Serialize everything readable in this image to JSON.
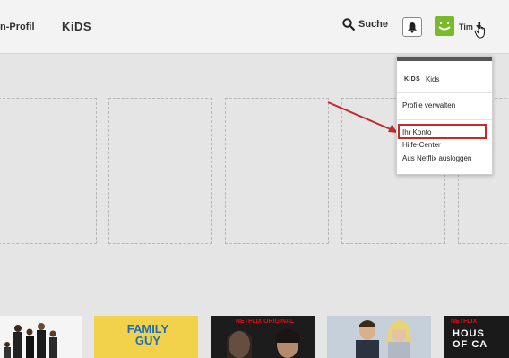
{
  "header": {
    "profile_link": "n-Profil",
    "kids_link": "KiDS",
    "search_label": "Suche",
    "profile_name": "Tim"
  },
  "dropdown": {
    "kids_logo": "KIDS",
    "kids_label": "Kids",
    "items": [
      "Profile verwalten",
      "Ihr Konto",
      "Hilfe-Center",
      "Aus Netflix ausloggen"
    ]
  },
  "rows": {
    "thumbs": [
      {
        "logo": ""
      },
      {
        "logo": "FAMILY GUY"
      },
      {
        "badge": "NETFLIX ORIGINAL"
      },
      {
        "badge": ""
      },
      {
        "badge": "NETFLIX",
        "title": "HOUS OF CA"
      }
    ]
  },
  "colors": {
    "accent_red": "#c52a2a",
    "avatar_green": "#7ab928",
    "netflix_red": "#e50914"
  },
  "icons": [
    "search-icon",
    "bell-icon",
    "smiley-avatar-icon",
    "caret-down-icon",
    "hand-cursor-icon",
    "red-arrow-annotation"
  ]
}
